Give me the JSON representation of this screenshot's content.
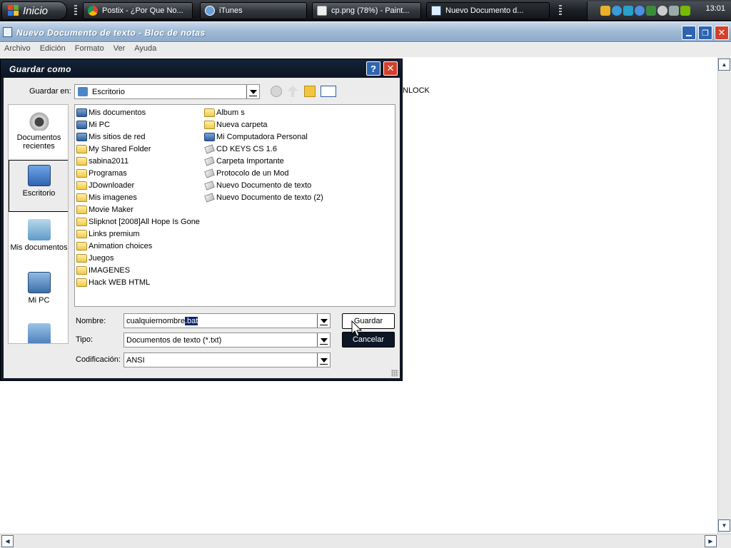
{
  "taskbar": {
    "start_label": "Inicio",
    "tasks": [
      {
        "label": "Postix - ¿Por Que No..."
      },
      {
        "label": "iTunes"
      },
      {
        "label": "cp.png (78%) - Paint..."
      },
      {
        "label": "Nuevo Documento d..."
      }
    ],
    "clock": "13:01"
  },
  "notepad": {
    "title": "Nuevo Documento de texto - Bloc de notas",
    "menu": [
      "Archivo",
      "Edición",
      "Formato",
      "Ver",
      "Ayuda"
    ],
    "visible_text": "NLOCK"
  },
  "dialog": {
    "title": "Guardar como",
    "save_in_label": "Guardar en:",
    "save_in_value": "Escritorio",
    "places": [
      {
        "label": "Documentos recientes"
      },
      {
        "label": "Escritorio"
      },
      {
        "label": "Mis documentos"
      },
      {
        "label": "Mi PC"
      }
    ],
    "files_col1": [
      {
        "name": "Mis documentos",
        "kind": "sys"
      },
      {
        "name": "Mi PC",
        "kind": "sys"
      },
      {
        "name": "Mis sitios de red",
        "kind": "sys"
      },
      {
        "name": "My Shared Folder",
        "kind": "folder"
      },
      {
        "name": "sabina2011",
        "kind": "folder"
      },
      {
        "name": "Programas",
        "kind": "folder"
      },
      {
        "name": "JDownloader",
        "kind": "folder"
      },
      {
        "name": "Mis imagenes",
        "kind": "folder"
      },
      {
        "name": "Movie Maker",
        "kind": "folder"
      },
      {
        "name": "Slipknot [2008]All Hope Is Gone",
        "kind": "folder"
      },
      {
        "name": "Links premium",
        "kind": "folder"
      },
      {
        "name": "Animation choices",
        "kind": "folder"
      },
      {
        "name": "Juegos",
        "kind": "folder"
      },
      {
        "name": "IMAGENES",
        "kind": "folder"
      },
      {
        "name": "Hack WEB HTML",
        "kind": "folder"
      }
    ],
    "files_col2": [
      {
        "name": "Album s",
        "kind": "folder"
      },
      {
        "name": "Nueva carpeta",
        "kind": "folder"
      },
      {
        "name": "Mi Computadora Personal",
        "kind": "sys"
      },
      {
        "name": "CD KEYS CS 1.6",
        "kind": "doc"
      },
      {
        "name": "Carpeta Importante",
        "kind": "doc"
      },
      {
        "name": "Protocolo de un Mod",
        "kind": "doc"
      },
      {
        "name": "Nuevo Documento de texto",
        "kind": "doc"
      },
      {
        "name": "Nuevo Documento de texto (2)",
        "kind": "doc"
      }
    ],
    "name_label": "Nombre:",
    "name_value_plain": "cualquiernombre",
    "name_value_selected": ".bat",
    "type_label": "Tipo:",
    "type_value": "Documentos de texto (*.txt)",
    "encoding_label": "Codificación:",
    "encoding_value": "ANSI",
    "save_button": "Guardar",
    "cancel_button": "Cancelar"
  }
}
